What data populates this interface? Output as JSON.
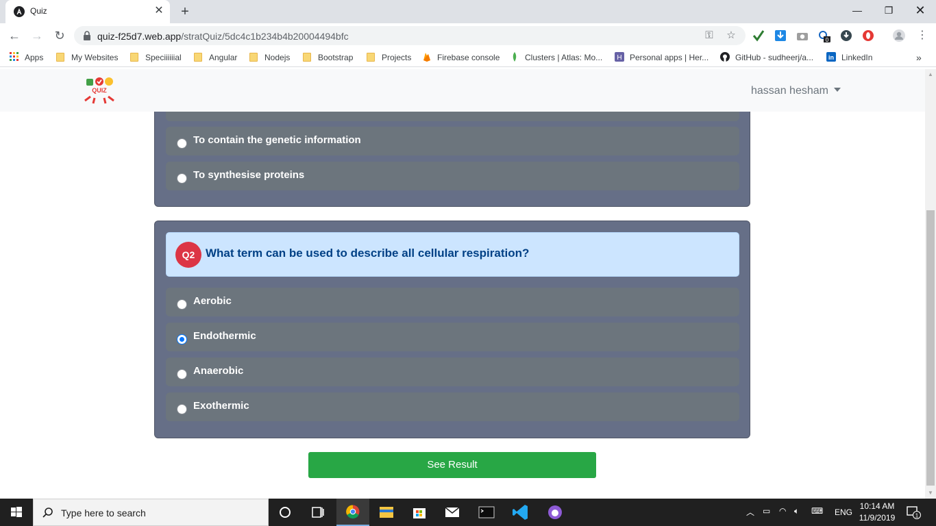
{
  "browser": {
    "tab_title": "Quiz",
    "url_host": "quiz-f25d7.web.app",
    "url_path": "/stratQuiz/5dc4c1b234b4b20004494bfc",
    "extension_badge": "0"
  },
  "bookmarks": [
    {
      "label": "Apps",
      "icon": "apps-grid-icon"
    },
    {
      "label": "My Websites",
      "icon": "folder-icon"
    },
    {
      "label": "Speciiiiiial",
      "icon": "folder-icon"
    },
    {
      "label": "Angular",
      "icon": "folder-icon"
    },
    {
      "label": "Nodejs",
      "icon": "folder-icon"
    },
    {
      "label": "Bootstrap",
      "icon": "folder-icon"
    },
    {
      "label": "Projects",
      "icon": "folder-icon"
    },
    {
      "label": "Firebase console",
      "icon": "firebase-icon"
    },
    {
      "label": "Clusters | Atlas: Mo...",
      "icon": "mongodb-leaf-icon"
    },
    {
      "label": "Personal apps | Her...",
      "icon": "heroku-icon"
    },
    {
      "label": "GitHub - sudheerj/a...",
      "icon": "github-icon"
    },
    {
      "label": "LinkedIn",
      "icon": "linkedin-icon"
    }
  ],
  "navbar": {
    "logo_text": "QUIZ",
    "user_name": "hassan hesham"
  },
  "q1": {
    "options": [
      {
        "label": "To contain the genetic information",
        "checked": false
      },
      {
        "label": "To synthesise proteins",
        "checked": false
      }
    ]
  },
  "q2": {
    "badge": "Q2",
    "question": "What term can be used to describe all cellular respiration?",
    "options": [
      {
        "label": "Aerobic",
        "checked": false
      },
      {
        "label": "Endothermic",
        "checked": true
      },
      {
        "label": "Anaerobic",
        "checked": false
      },
      {
        "label": "Exothermic",
        "checked": false
      }
    ]
  },
  "actions": {
    "see_result": "See Result"
  },
  "taskbar": {
    "search_placeholder": "Type here to search",
    "time": "10:14 AM",
    "date": "11/9/2019",
    "language": "ENG",
    "notification_count": "1"
  },
  "colors": {
    "card_bg": "#666f87",
    "option_bg": "#6c757d",
    "question_bg": "#cce5ff",
    "question_text": "#004085",
    "badge": "#dc3545",
    "button": "#28a745",
    "radio_checked": "#0075ff"
  }
}
